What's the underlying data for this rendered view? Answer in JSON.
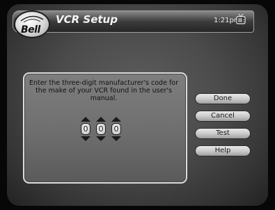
{
  "header": {
    "logo_text": "Bell",
    "title": "VCR Setup",
    "time": "1:21pm"
  },
  "dialog": {
    "instructions": "Enter the three-digit manufacturer's code for the make of your VCR found in the user's manual.",
    "digits": [
      "0",
      "0",
      "0"
    ]
  },
  "buttons": {
    "done": "Done",
    "cancel": "Cancel",
    "test": "Test",
    "help": "Help"
  },
  "icons": {
    "logo": "bell-logo-icon",
    "tv": "tv-icon",
    "increment": "arrow-up-icon",
    "decrement": "arrow-down-icon"
  },
  "colors": {
    "header_bar": "#3c3c3c",
    "panel": "#6e6e6e",
    "button": "#c8c8c8",
    "border": "#dcdcdc"
  }
}
